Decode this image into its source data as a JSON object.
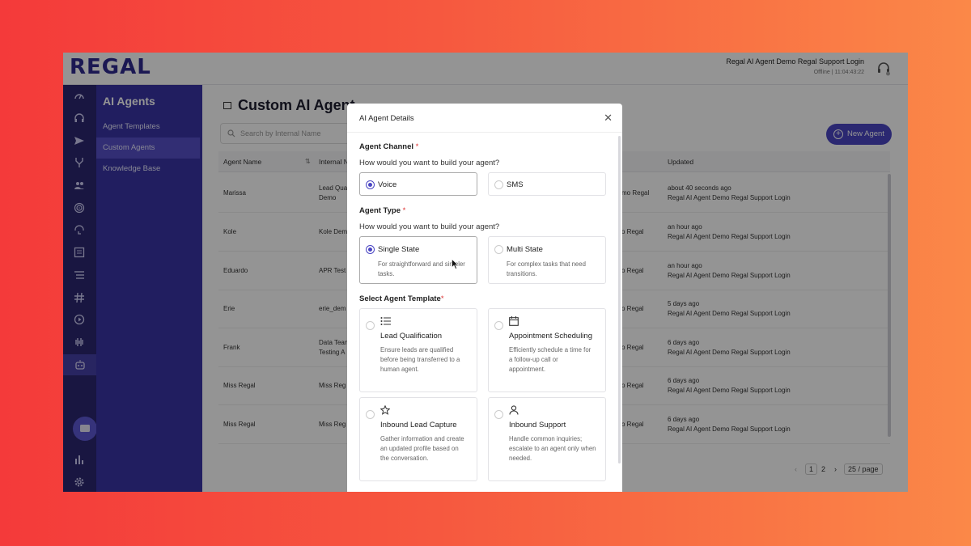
{
  "header": {
    "logo": "REGAL",
    "user_name": "Regal AI Agent Demo Regal Support Login",
    "status": "Offline",
    "separator": "|",
    "timer": "11:04:43:22"
  },
  "rail": {
    "icons": [
      "gauge-icon",
      "headset-icon",
      "send-icon",
      "branch-icon",
      "contacts-icon",
      "fingerprint-icon",
      "support-icon",
      "report-icon",
      "list-icon",
      "hash-icon",
      "play-icon",
      "waveform-icon",
      "bot-icon",
      "chat-icon",
      "bar-chart-icon",
      "gear-icon"
    ]
  },
  "subnav": {
    "title": "AI Agents",
    "items": [
      {
        "label": "Agent Templates"
      },
      {
        "label": "Custom Agents"
      },
      {
        "label": "Knowledge Base"
      }
    ]
  },
  "main": {
    "title": "Custom AI Agent",
    "search_placeholder": "Search by Internal Name",
    "new_agent_label": "New Agent",
    "columns": {
      "name": "Agent Name",
      "internal": "Internal N",
      "updated": "Updated"
    },
    "rows": [
      {
        "name": "Marissa",
        "internal": "Lead Qual",
        "internal2": "Demo",
        "created": "mo Regal",
        "updated": "about 40 seconds ago",
        "updated_by": "Regal AI Agent Demo Regal Support Login"
      },
      {
        "name": "Kole",
        "internal": "Kole Dem",
        "internal2": "",
        "created": "o Regal",
        "updated": "an hour ago",
        "updated_by": "Regal AI Agent Demo Regal Support Login"
      },
      {
        "name": "Eduardo",
        "internal": "APR Test",
        "internal2": "",
        "created": "o Regal",
        "updated": "an hour ago",
        "updated_by": "Regal AI Agent Demo Regal Support Login"
      },
      {
        "name": "Erie",
        "internal": "erie_dem",
        "internal2": "",
        "created": "o Regal",
        "updated": "5 days ago",
        "updated_by": "Regal AI Agent Demo Regal Support Login"
      },
      {
        "name": "Frank",
        "internal": "Data Team",
        "internal2": "Testing A",
        "created": "o Regal",
        "updated": "6 days ago",
        "updated_by": "Regal AI Agent Demo Regal Support Login"
      },
      {
        "name": "Miss Regal",
        "internal": "Miss Reg",
        "internal2": "",
        "created": "o Regal",
        "updated": "6 days ago",
        "updated_by": "Regal AI Agent Demo Regal Support Login"
      },
      {
        "name": "Miss Regal",
        "internal": "Miss Reg",
        "internal2": "",
        "created": "o Regal",
        "updated": "6 days ago",
        "updated_by": "Regal AI Agent Demo Regal Support Login"
      }
    ],
    "pagination": {
      "page1": "1",
      "page2": "2",
      "per_page": "25 / page"
    }
  },
  "modal": {
    "title": "AI Agent Details",
    "channel_label": "Agent Channel",
    "channel_question": "How would you want to build your agent?",
    "channel_options": [
      {
        "label": "Voice",
        "selected": true
      },
      {
        "label": "SMS",
        "selected": false
      }
    ],
    "type_label": "Agent Type",
    "type_question": "How would you want to build your agent?",
    "type_options": [
      {
        "label": "Single State",
        "desc1": "For straightforward and simpler",
        "desc2": "tasks.",
        "selected": true
      },
      {
        "label": "Multi State",
        "desc1": "For complex tasks that need",
        "desc2": "transitions.",
        "selected": false
      }
    ],
    "template_label": "Select Agent Template",
    "templates": [
      {
        "icon": "list-icon",
        "label": "Lead Qualification",
        "d1": "Ensure leads are qualified",
        "d2": "before being transferred to a",
        "d3": "human agent."
      },
      {
        "icon": "calendar-icon",
        "label": "Appointment Scheduling",
        "d1": "Efficiently schedule a time for",
        "d2": "a follow-up call or",
        "d3": "appointment."
      },
      {
        "icon": "star-icon",
        "label": "Inbound Lead Capture",
        "d1": "Gather information and create",
        "d2": "an updated profile based on",
        "d3": "the conversation."
      },
      {
        "icon": "person-icon",
        "label": "Inbound Support",
        "d1": "Handle common inquiries;",
        "d2": "escalate to an agent only when",
        "d3": "needed."
      }
    ],
    "required_mark": "*"
  },
  "colors": {
    "brand": "#2f2a8f",
    "accent": "#4a45c3",
    "nav": "#3a35a6"
  }
}
